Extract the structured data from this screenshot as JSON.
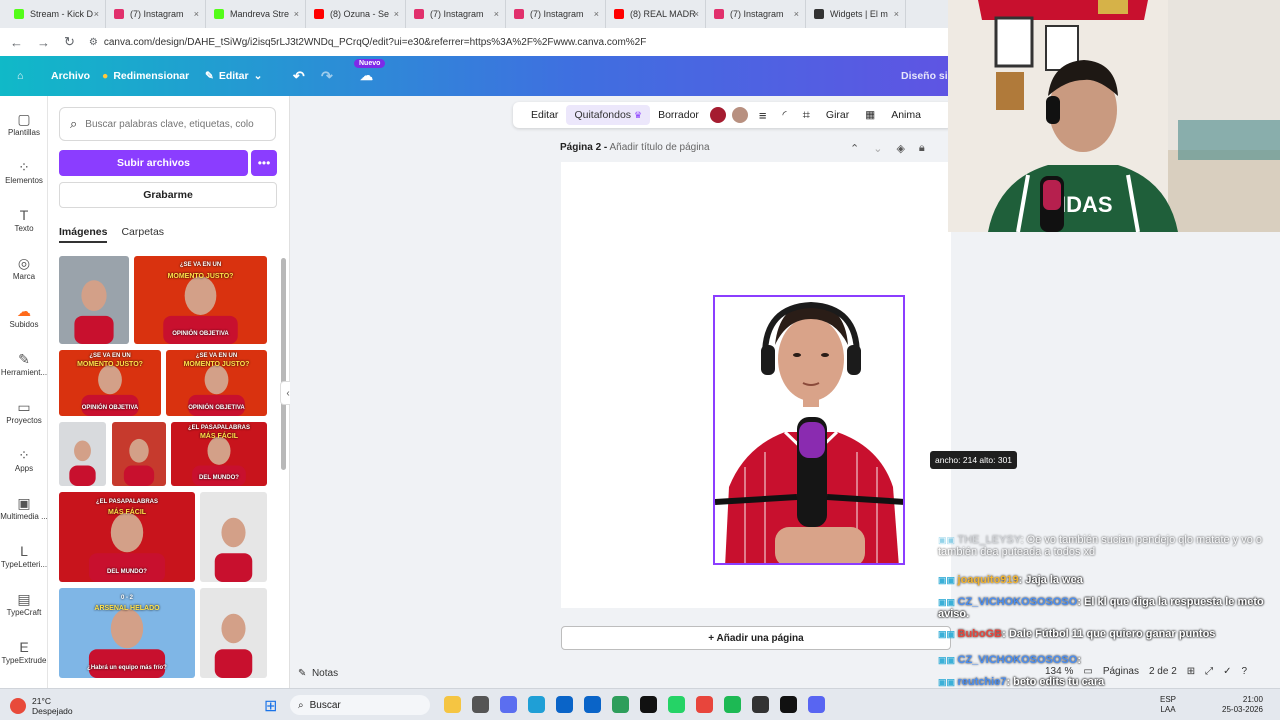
{
  "browser": {
    "tabs": [
      {
        "label": "Stream - Kick D",
        "color": "#53fc18"
      },
      {
        "label": "(7) Instagram",
        "color": "#e1306c"
      },
      {
        "label": "Mandreva Stre",
        "color": "#53fc18"
      },
      {
        "label": "(8) Ozuna - Se",
        "color": "#ff0000"
      },
      {
        "label": "(7) Instagram",
        "color": "#e1306c"
      },
      {
        "label": "(7) Instagram",
        "color": "#e1306c"
      },
      {
        "label": "(8) REAL MADR",
        "color": "#ff0000"
      },
      {
        "label": "(7) Instagram",
        "color": "#e1306c"
      },
      {
        "label": "Widgets | El m",
        "color": "#333333"
      }
    ],
    "url": "canva.com/design/DAHE_tSiWg/i2isq5rLJ3t2WNDq_PCrqQ/edit?ui=e30&referrer=https%3A%2F%2Fwww.canva.com%2F"
  },
  "header": {
    "archivo": "Archivo",
    "redimensionar": "Redimensionar",
    "editar": "Editar",
    "nuevo_badge": "Nuevo",
    "diseno": "Diseño sin"
  },
  "rail": [
    {
      "label": "Plantillas",
      "icon": "templates-icon",
      "glyph": "▢"
    },
    {
      "label": "Elementos",
      "icon": "elements-icon",
      "glyph": "⁘"
    },
    {
      "label": "Texto",
      "icon": "text-icon",
      "glyph": "T"
    },
    {
      "label": "Marca",
      "icon": "brand-icon",
      "glyph": "◎"
    },
    {
      "label": "Subidos",
      "icon": "uploads-icon",
      "glyph": "☁"
    },
    {
      "label": "Herramient...",
      "icon": "tools-icon",
      "glyph": "✎"
    },
    {
      "label": "Proyectos",
      "icon": "projects-icon",
      "glyph": "▭"
    },
    {
      "label": "Apps",
      "icon": "apps-icon",
      "glyph": "⁘"
    },
    {
      "label": "Multimedia ...",
      "icon": "media-icon",
      "glyph": "▣"
    },
    {
      "label": "TypeLetteri...",
      "icon": "typelettering-icon",
      "glyph": "L"
    },
    {
      "label": "TypeCraft",
      "icon": "typecraft-icon",
      "glyph": "▤"
    },
    {
      "label": "TypeExtrude",
      "icon": "typeextrude-icon",
      "glyph": "E"
    }
  ],
  "panel": {
    "search_placeholder": "Buscar palabras clave, etiquetas, colo",
    "upload": "Subir archivos",
    "record": "Grabarme",
    "tab_images": "Imágenes",
    "tab_folders": "Carpetas",
    "thumbs": [
      {
        "top": "",
        "mid": "",
        "bot": "",
        "bg": "#9aa3ab"
      },
      {
        "top": "¿SE VA EN UN",
        "mid": "MOMENTO JUSTO?",
        "bot": "OPINIÓN OBJETIVA",
        "bg": "#d9320f"
      },
      {
        "top": "¿SE VA EN UN",
        "mid": "MOMENTO JUSTO?",
        "bot": "OPINIÓN OBJETIVA",
        "bg": "#d9320f"
      },
      {
        "top": "¿SE VA EN UN",
        "mid": "MOMENTO JUSTO?",
        "bot": "OPINIÓN OBJETIVA",
        "bg": "#d9320f"
      },
      {
        "top": "",
        "mid": "",
        "bot": "",
        "bg": "#d8dadd"
      },
      {
        "top": "",
        "mid": "",
        "bot": "",
        "bg": "#c63a2d"
      },
      {
        "top": "¿EL PASAPALABRAS",
        "mid": "MÁS FÁCIL",
        "bot": "DEL MUNDO?",
        "bg": "#c8141c"
      },
      {
        "top": "¿EL PASAPALABRAS",
        "mid": "MÁS FÁCIL",
        "bot": "DEL MUNDO?",
        "bg": "#c8141c"
      },
      {
        "top": "",
        "mid": "",
        "bot": "",
        "bg": "#e6e6e6"
      },
      {
        "top": "0 - 2",
        "mid": "ARSENAL HELADO",
        "bot": "¿Habrá un equipo más frío?",
        "bg": "#7fb6e6"
      },
      {
        "top": "",
        "mid": "",
        "bot": "",
        "bg": "#e6e6e6"
      }
    ]
  },
  "toolbar": {
    "editar": "Editar",
    "quitafondos": "Quitafondos",
    "borrador": "Borrador",
    "girar": "Girar",
    "animar": "Anima",
    "color1": "#a51c30",
    "color2": "#b89080"
  },
  "page": {
    "label": "Página 2 -",
    "title_placeholder": "Añadir título de página",
    "dimensions": "ancho: 214 alto: 301",
    "add_page": "+ Añadir una página",
    "notes": "Notas",
    "zoom": "134 %",
    "pages": "Páginas",
    "page_count": "2 de 2"
  },
  "chat": [
    {
      "user": "THE_LEYSY",
      "text": ": Oe vo también sucian pendejo qlo matate y vo o también dea puteada a todos xd",
      "color": "#b8bcc2"
    },
    {
      "user": "joaquito919",
      "text": ": Jaja la wea",
      "color": "#f2b531"
    },
    {
      "user": "CZ_VICHOKOSOSOSO",
      "text": ": El kl que diga la respuesta le meto aviso.",
      "color": "#4b8ef0"
    },
    {
      "user": "BuboGB",
      "text": ": Dale Fútbol 11 que quiero ganar puntos",
      "color": "#e8453c"
    },
    {
      "user": "CZ_VICHOKOSOSOSO",
      "text": ":",
      "color": "#4b8ef0"
    },
    {
      "user": "reutchie7",
      "text": ": beto edits tu cara",
      "color": "#4b8ef0"
    },
    {
      "user": "CZ_VICHOKOSOSOSO",
      "text": ":",
      "color": "#4b8ef0"
    }
  ],
  "taskbar": {
    "temp": "21°C",
    "weather": "Despejado",
    "search": "Buscar",
    "lang": "ESP",
    "region": "LAA",
    "time": "21:00",
    "date": "25-03-2026"
  }
}
